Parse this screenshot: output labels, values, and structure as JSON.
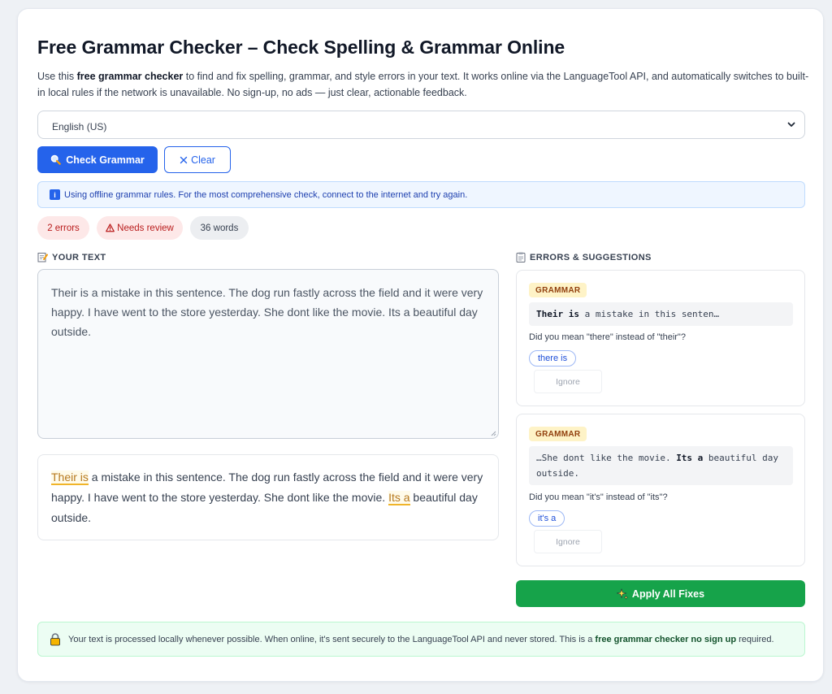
{
  "header": {
    "title": "Free Grammar Checker – Check Spelling & Grammar Online",
    "intro_prefix": "Use this ",
    "intro_bold": "free grammar checker",
    "intro_suffix": " to find and fix spelling, grammar, and style errors in your text. It works online via the LanguageTool API, and automatically switches to built-in local rules if the network is unavailable. No sign-up, no ads — just clear, actionable feedback."
  },
  "language_select": {
    "selected": "English (US)"
  },
  "toolbar": {
    "check_label": "Check Grammar",
    "clear_label": "Clear"
  },
  "notice": {
    "text": "Using offline grammar rules. For the most comprehensive check, connect to the internet and try again."
  },
  "stats": {
    "errors": "2 errors",
    "review": "Needs review",
    "words": "36 words"
  },
  "editor": {
    "label": "YOUR TEXT",
    "text": "Their is a mistake in this sentence. The dog run fastly across the field and it were very happy. I have went to the store yesterday. She dont like the movie. Its a beautiful day outside."
  },
  "preview": {
    "hl1": "Their is",
    "seg1": " a mistake in this sentence. The dog run fastly across the field and it were very happy. I have went to the store yesterday. She dont like the movie. ",
    "hl2": "Its a",
    "seg2": " beautiful day outside."
  },
  "suggestions_panel": {
    "label": "ERRORS & SUGGESTIONS",
    "errors": [
      {
        "type": "GRAMMAR",
        "snippet_bold": "Their is",
        "snippet_after": " a mistake in this senten…",
        "message": "Did you mean \"there\" instead of \"their\"?",
        "suggestion": "there is",
        "ignore": "Ignore"
      },
      {
        "type": "GRAMMAR",
        "snippet_before": "…She dont like the movie. ",
        "snippet_bold": "Its a",
        "snippet_after": " beautiful day outside.",
        "message": "Did you mean \"it's\" instead of \"its\"?",
        "suggestion": "it's a",
        "ignore": "Ignore"
      }
    ],
    "apply_all": "Apply All Fixes"
  },
  "privacy": {
    "prefix": "Your text is processed locally whenever possible. When online, it's sent securely to the LanguageTool API and never stored. This is a ",
    "bold": "free grammar checker no sign up",
    "suffix": " required."
  },
  "colors": {
    "primary": "#2563eb",
    "success": "#16a34a",
    "error": "#b91c1c",
    "highlight": "#f0b429"
  }
}
